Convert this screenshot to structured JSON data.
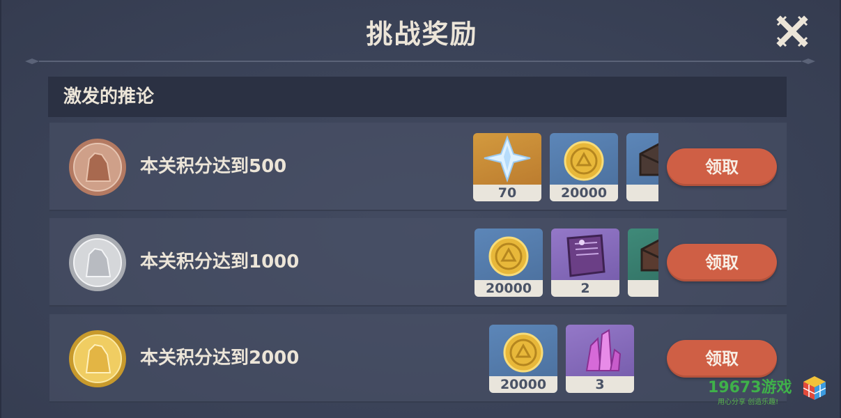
{
  "dialog": {
    "title": "挑战奖励",
    "close_icon": "close-icon"
  },
  "section": {
    "header": "激发的推论"
  },
  "rows": [
    {
      "medal": "bronze-medal-icon",
      "label": "本关积分达到500",
      "items": [
        {
          "icon": "primogem-icon",
          "count": "70",
          "rarity_color": "#d39a3e"
        },
        {
          "icon": "mora-coin-icon",
          "count": "20000",
          "rarity_color": "#5c86b8"
        },
        {
          "icon": "ore-chest-icon",
          "count": "",
          "rarity_color": "#5c86b8"
        }
      ],
      "button": "领取"
    },
    {
      "medal": "silver-medal-icon",
      "label": "本关积分达到1000",
      "items": [
        {
          "icon": "mora-coin-icon",
          "count": "20000",
          "rarity_color": "#5c86b8"
        },
        {
          "icon": "book-icon",
          "count": "2",
          "rarity_color": "#9478c8"
        },
        {
          "icon": "ore-chest-icon",
          "count": "",
          "rarity_color": "#3f8a79"
        }
      ],
      "button": "领取"
    },
    {
      "medal": "gold-medal-icon",
      "label": "本关积分达到2000",
      "items": [
        {
          "icon": "mora-coin-icon",
          "count": "20000",
          "rarity_color": "#5c86b8"
        },
        {
          "icon": "crystal-icon",
          "count": "3",
          "rarity_color": "#9478c8"
        }
      ],
      "button": "领取"
    }
  ],
  "watermark": {
    "text": "19673游戏",
    "subtext": "用心分享 创造乐趣!"
  },
  "colors": {
    "button": "#cf5f45",
    "title_text": "#ece5d8",
    "panel": "#3b4358"
  }
}
